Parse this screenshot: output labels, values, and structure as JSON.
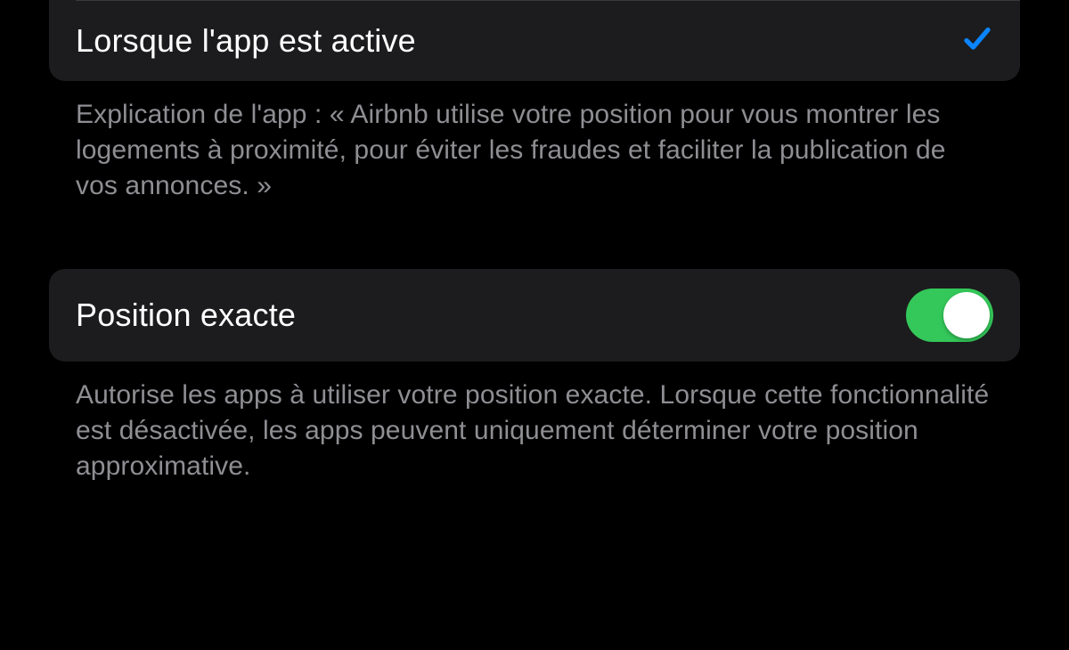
{
  "location_access": {
    "option_while_using_label": "Lorsque l'app est active",
    "explanation": "Explication de l'app : « Airbnb utilise votre position pour vous montrer les logements à proximité, pour éviter les fraudes et faciliter la publication de vos annonces. »"
  },
  "precise_location": {
    "label": "Position exacte",
    "enabled": true,
    "description": "Autorise les apps à utiliser votre position exacte. Lorsque cette fonctionnalité est désactivée, les apps peuvent uniquement déterminer votre position approximative."
  }
}
